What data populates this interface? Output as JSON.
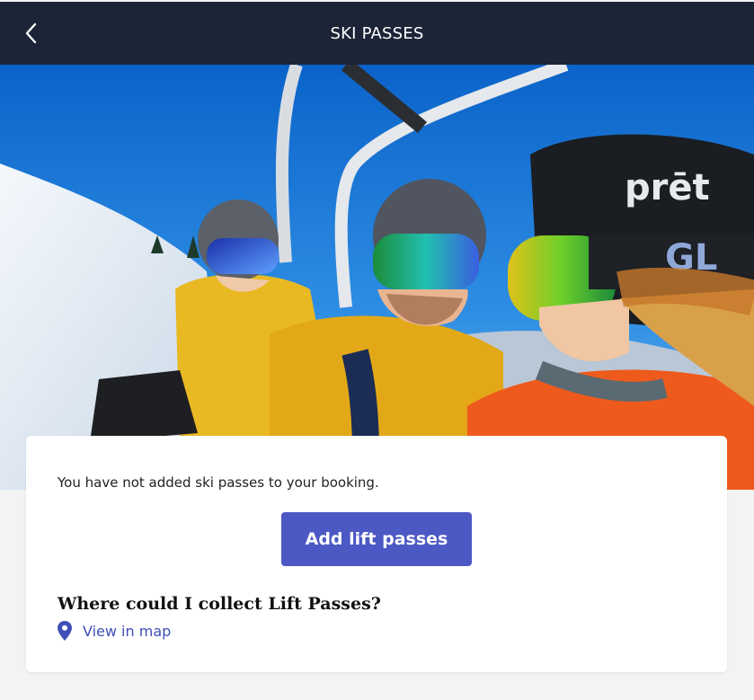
{
  "header": {
    "title": "SKI PASSES",
    "back_icon": "chevron-left-icon"
  },
  "hero": {
    "description_icon": "ski-lift-photo"
  },
  "card": {
    "message": "You have not added ski passes to your booking.",
    "add_button_label": "Add lift passes",
    "collect_heading": "Where could I collect Lift Passes?",
    "map_link_label": "View in map",
    "map_icon": "map-pin-icon"
  },
  "colors": {
    "header_bg": "#1c2438",
    "accent": "#4c58c4",
    "link": "#3f4fb6",
    "page_bg": "#f3f3f3"
  }
}
